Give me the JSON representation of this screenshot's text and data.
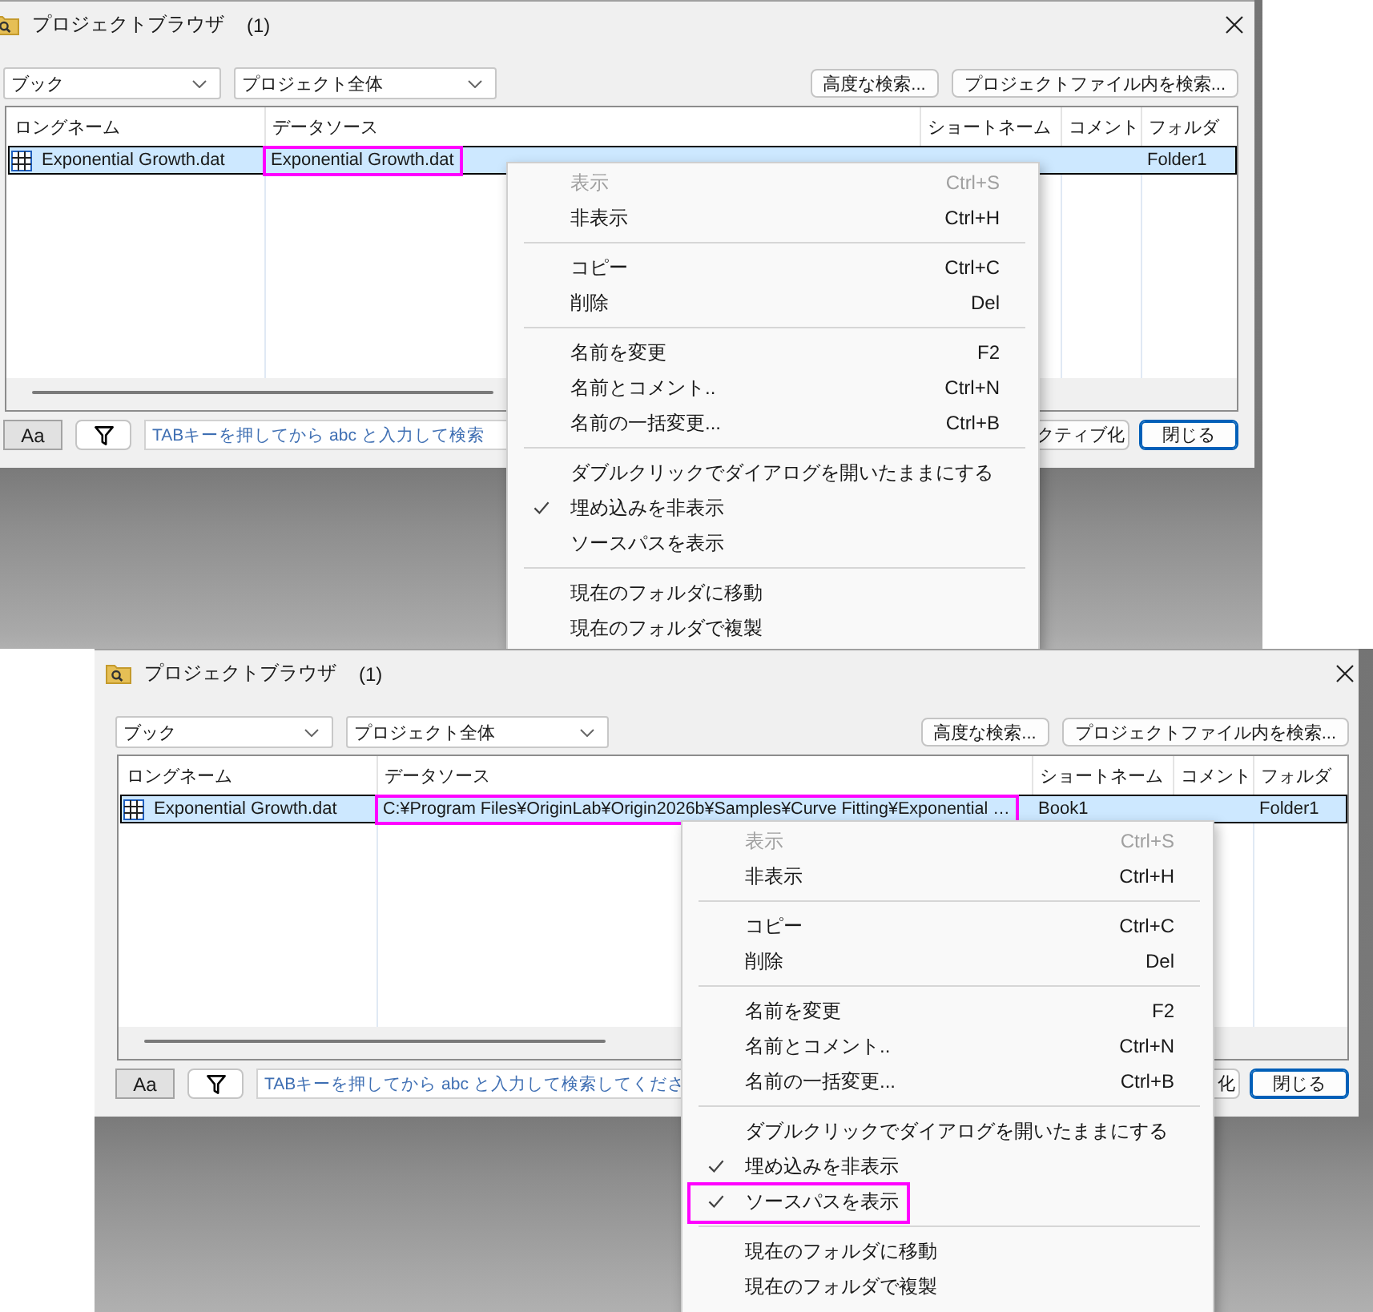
{
  "screens": [
    {
      "window": {
        "title": "プロジェクトブラウザ",
        "count": "(1)"
      },
      "dropdowns": [
        {
          "value": "ブック"
        },
        {
          "value": "プロジェクト全体"
        }
      ],
      "search_buttons": [
        {
          "label": "高度な検索..."
        },
        {
          "label": "プロジェクトファイル内を検索..."
        }
      ],
      "table": {
        "columns": [
          "ロングネーム",
          "データソース",
          "ショートネーム",
          "コメント",
          "フォルダ"
        ],
        "rows": [
          {
            "selected": true,
            "long_name": "Exponential Growth.dat",
            "data_source": "Exponential Growth.dat",
            "folder": "Folder1",
            "data_source_highlighted": true
          }
        ]
      },
      "bottom_bar": {
        "case_toggle": {
          "label": "Aa",
          "on": true
        },
        "search": {
          "placeholder": "TABキーを押してから abc と入力して検索"
        },
        "buttons": [
          {
            "label": "クティブ化",
            "default": false
          },
          {
            "label": "閉じる",
            "default": true
          }
        ]
      },
      "menu": {
        "items": [
          {
            "kind": "item",
            "label": "表示",
            "shortcut": "Ctrl+S",
            "disabled": true,
            "checked": false,
            "highlighted": false
          },
          {
            "kind": "item",
            "label": "非表示",
            "shortcut": "Ctrl+H",
            "disabled": false,
            "checked": false,
            "highlighted": false
          },
          {
            "kind": "separator"
          },
          {
            "kind": "item",
            "label": "コピー",
            "shortcut": "Ctrl+C",
            "disabled": false,
            "checked": false,
            "highlighted": false
          },
          {
            "kind": "item",
            "label": "削除",
            "shortcut": "Del",
            "disabled": false,
            "checked": false,
            "highlighted": false
          },
          {
            "kind": "separator"
          },
          {
            "kind": "item",
            "label": "名前を変更",
            "shortcut": "F2",
            "disabled": false,
            "checked": false,
            "highlighted": false
          },
          {
            "kind": "item",
            "label": "名前とコメント..",
            "shortcut": "Ctrl+N",
            "disabled": false,
            "checked": false,
            "highlighted": false
          },
          {
            "kind": "item",
            "label": "名前の一括変更...",
            "shortcut": "Ctrl+B",
            "disabled": false,
            "checked": false,
            "highlighted": false
          },
          {
            "kind": "separator"
          },
          {
            "kind": "item",
            "label": "ダブルクリックでダイアログを開いたままにする",
            "disabled": false,
            "checked": false,
            "highlighted": false
          },
          {
            "kind": "item",
            "label": "埋め込みを非表示",
            "disabled": false,
            "checked": true,
            "highlighted": false
          },
          {
            "kind": "item",
            "label": "ソースパスを表示",
            "disabled": false,
            "checked": false,
            "highlighted": false
          },
          {
            "kind": "separator"
          },
          {
            "kind": "item",
            "label": "現在のフォルダに移動",
            "disabled": false,
            "checked": false,
            "highlighted": false
          },
          {
            "kind": "item",
            "label": "現在のフォルダで複製",
            "disabled": false,
            "checked": false,
            "highlighted": false
          }
        ]
      }
    },
    {
      "window": {
        "title": "プロジェクトブラウザ",
        "count": "(1)"
      },
      "dropdowns": [
        {
          "value": "ブック"
        },
        {
          "value": "プロジェクト全体"
        }
      ],
      "search_buttons": [
        {
          "label": "高度な検索..."
        },
        {
          "label": "プロジェクトファイル内を検索..."
        }
      ],
      "table": {
        "columns": [
          "ロングネーム",
          "データソース",
          "ショートネーム",
          "コメント",
          "フォルダ"
        ],
        "rows": [
          {
            "selected": true,
            "long_name": "Exponential Growth.dat",
            "data_source": "C:¥Program Files¥OriginLab¥Origin2026b¥Samples¥Curve Fitting¥Exponential …",
            "short_name": "Book1",
            "folder": "Folder1",
            "data_source_highlighted": true
          }
        ]
      },
      "bottom_bar": {
        "case_toggle": {
          "label": "Aa",
          "on": true
        },
        "search": {
          "placeholder": "TABキーを押してから abc と入力して検索してくださ"
        },
        "buttons": [
          {
            "label": "化",
            "default": false
          },
          {
            "label": "閉じる",
            "default": true
          }
        ]
      },
      "menu": {
        "items": [
          {
            "kind": "item",
            "label": "表示",
            "shortcut": "Ctrl+S",
            "disabled": true,
            "checked": false,
            "highlighted": false
          },
          {
            "kind": "item",
            "label": "非表示",
            "shortcut": "Ctrl+H",
            "disabled": false,
            "checked": false,
            "highlighted": false
          },
          {
            "kind": "separator"
          },
          {
            "kind": "item",
            "label": "コピー",
            "shortcut": "Ctrl+C",
            "disabled": false,
            "checked": false,
            "highlighted": false
          },
          {
            "kind": "item",
            "label": "削除",
            "shortcut": "Del",
            "disabled": false,
            "checked": false,
            "highlighted": false
          },
          {
            "kind": "separator"
          },
          {
            "kind": "item",
            "label": "名前を変更",
            "shortcut": "F2",
            "disabled": false,
            "checked": false,
            "highlighted": false
          },
          {
            "kind": "item",
            "label": "名前とコメント..",
            "shortcut": "Ctrl+N",
            "disabled": false,
            "checked": false,
            "highlighted": false
          },
          {
            "kind": "item",
            "label": "名前の一括変更...",
            "shortcut": "Ctrl+B",
            "disabled": false,
            "checked": false,
            "highlighted": false
          },
          {
            "kind": "separator"
          },
          {
            "kind": "item",
            "label": "ダブルクリックでダイアログを開いたままにする",
            "disabled": false,
            "checked": false,
            "highlighted": false
          },
          {
            "kind": "item",
            "label": "埋め込みを非表示",
            "disabled": false,
            "checked": true,
            "highlighted": false
          },
          {
            "kind": "item",
            "label": "ソースパスを表示",
            "disabled": false,
            "checked": true,
            "highlighted": true
          },
          {
            "kind": "separator"
          },
          {
            "kind": "item",
            "label": "現在のフォルダに移動",
            "disabled": false,
            "checked": false,
            "highlighted": false
          },
          {
            "kind": "item",
            "label": "現在のフォルダで複製",
            "disabled": false,
            "checked": false,
            "highlighted": false
          }
        ]
      }
    }
  ]
}
